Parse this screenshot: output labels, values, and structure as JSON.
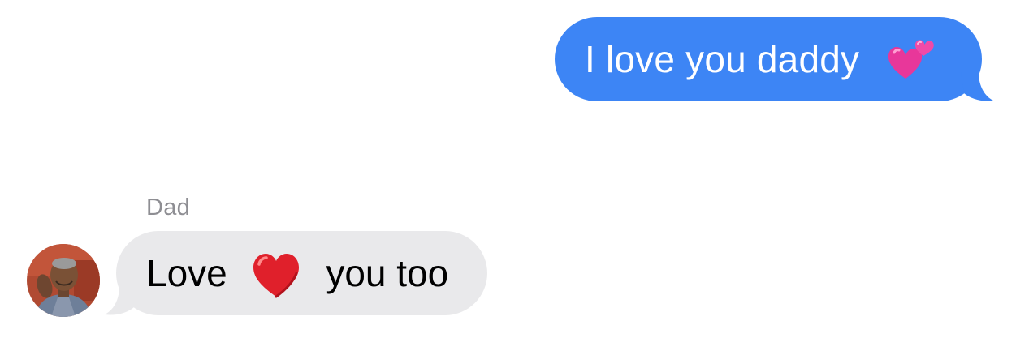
{
  "conversation": {
    "messages": [
      {
        "direction": "outgoing",
        "text": "I love you daddy",
        "emoji": "two-hearts-icon"
      },
      {
        "direction": "incoming",
        "sender": "Dad",
        "text_before": "Love",
        "emoji": "red-heart-icon",
        "text_after": "you too"
      }
    ]
  },
  "colors": {
    "outgoing_bubble": "#3d85f5",
    "incoming_bubble": "#e9e9eb",
    "sender_name": "#8e8e93",
    "heart_red": "#e0202b",
    "hearts_pink": "#e83a9b"
  }
}
